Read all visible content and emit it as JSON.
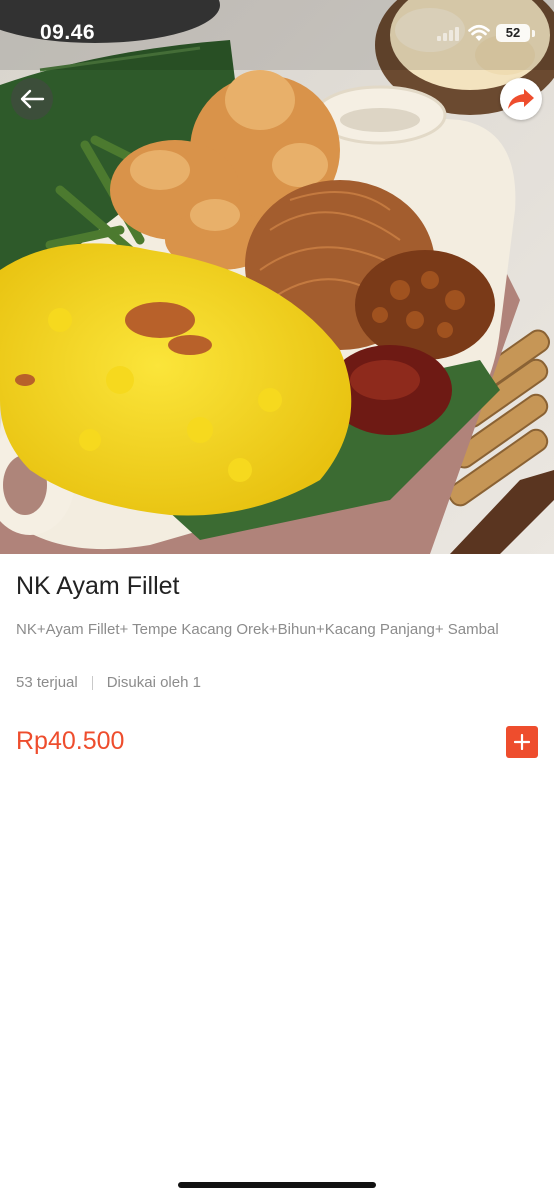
{
  "status_bar": {
    "time": "09.46",
    "battery": "52"
  },
  "product": {
    "name": "NK Ayam Fillet",
    "description": "NK+Ayam Fillet+ Tempe Kacang Orek+Bihun+Kacang Panjang+ Sambal",
    "sold": "53 terjual",
    "liked": "Disukai oleh 1",
    "price": "Rp40.500"
  },
  "icons": {
    "back": "arrow-left-icon",
    "share": "share-arrow-icon",
    "add": "plus-icon"
  },
  "colors": {
    "accent": "#ee4d2d",
    "text_primary": "#222222",
    "text_secondary": "#8c8c8c"
  }
}
